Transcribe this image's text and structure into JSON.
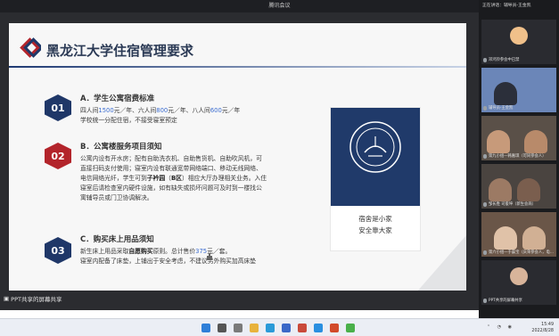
{
  "window": {
    "title": "腾讯会议",
    "controls": [
      "—",
      "□",
      "✕"
    ]
  },
  "slide": {
    "title": "黑龙江大学住宿管理要求",
    "sections": [
      {
        "num": "01",
        "heading": "A．学生公寓宿费标准",
        "line1_a": "四人间",
        "line1_b": "1500",
        "line1_c": "元／年、六人间",
        "line1_d": "800",
        "line1_e": "元／年、八人间",
        "line1_f": "600",
        "line1_g": "元／年",
        "line2": "学校统一分配住宿，不接受寝室预定"
      },
      {
        "num": "02",
        "heading": "B．公寓楼服务项目须知",
        "line1": "公寓内设有开水房；配有自助洗衣机、自助售货机、自助吹风机，可",
        "line2": "直接扫码支付使用；寝室内设有联通宽带网络端口、移动无线网络、",
        "line3_a": "电信网络光纤，学生可到",
        "line3_b": "子衿园",
        "line3_c": "（",
        "line3_d": "B区",
        "line3_e": "）相应大厅办理相关业务。入住",
        "line4": "寝室后请检查室内硬件设施，如有缺失或损坏问题可及时到一楼找公",
        "line5": "寓辅导员或门卫协调解决。"
      },
      {
        "num": "03",
        "heading": "C．购买床上用品须知",
        "line1_a": "新生床上用品采取",
        "line1_b": "自愿购买",
        "line1_c": "原则。总计售价",
        "line1_d": "375",
        "line1_e": "元／套。",
        "line2": "寝室内配备了床垫，上铺出于安全考虑，不建议另外购买加高床垫"
      }
    ],
    "card": {
      "line1": "宿舍是小家",
      "line2": "安全靠大家"
    }
  },
  "share_label": "PPT共享的屏幕共享",
  "side_panel": {
    "header": "正在讲话：辅导员-王金凯",
    "tiles": [
      {
        "caption": "邓鸿铃参会中已禁"
      },
      {
        "caption": "辅导员-王金凯"
      },
      {
        "caption": "第九小组—韩嘉琪（可同参会人）"
      },
      {
        "caption": "邹长胜 司俊坤（新生会商）"
      },
      {
        "caption": "第六小组—于晨宝（庆荣参会人，电…"
      },
      {
        "caption": "PPT共享的屏幕共享"
      }
    ]
  },
  "taskbar": {
    "time": "15:49",
    "date": "2022/8/28"
  },
  "colors": {
    "navy": "#1f3768",
    "red": "#b3242b",
    "highlight_blue": "#3f6fd1"
  }
}
